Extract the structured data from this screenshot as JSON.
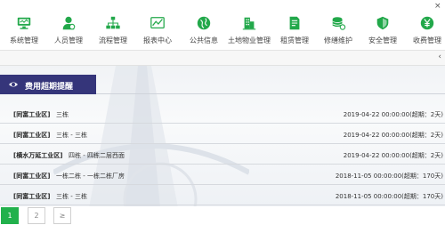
{
  "toolbar": {
    "close_glyph": "×",
    "accent_color": "#22a84a",
    "items": [
      {
        "label": "系统管理",
        "icon": "monitor-icon"
      },
      {
        "label": "人员管理",
        "icon": "user-icon"
      },
      {
        "label": "流程管理",
        "icon": "org-chart-icon"
      },
      {
        "label": "报表中心",
        "icon": "line-chart-icon"
      },
      {
        "label": "公共信息",
        "icon": "globe-icon"
      },
      {
        "label": "土地物业管理",
        "icon": "building-icon"
      },
      {
        "label": "租赁管理",
        "icon": "document-icon"
      },
      {
        "label": "修缮维护",
        "icon": "coins-wrench-icon"
      },
      {
        "label": "安全管理",
        "icon": "shield-icon"
      },
      {
        "label": "收费管理",
        "icon": "yen-icon"
      }
    ]
  },
  "subbar": {
    "chevron_glyph": "‹"
  },
  "section": {
    "title": "费用超期提醒",
    "icon": "eye-icon",
    "header_color": "#35357a"
  },
  "rows": [
    {
      "park": "[同富工业区]",
      "building": "三栋",
      "time": "2019-04-22 00:00:00(超期：2天)"
    },
    {
      "park": "[同富工业区]",
      "building": "三栋 - 三栋",
      "time": "2019-04-22 00:00:00(超期：2天)"
    },
    {
      "park": "[横水万延工业区]",
      "building": "四栋 - 四栋二层西面",
      "time": "2019-04-22 00:00:00(超期：2天)"
    },
    {
      "park": "[同富工业区]",
      "building": "一栋二栋 - 一栋二栋厂房",
      "time": "2018-11-05 00:00:00(超期：170天)"
    },
    {
      "park": "[同富工业区]",
      "building": "三栋 - 三栋",
      "time": "2018-11-05 00:00:00(超期：170天)"
    }
  ],
  "pagination": {
    "pages": [
      "1",
      "2"
    ],
    "next_glyph": "≥",
    "active_color": "#22b14c"
  }
}
